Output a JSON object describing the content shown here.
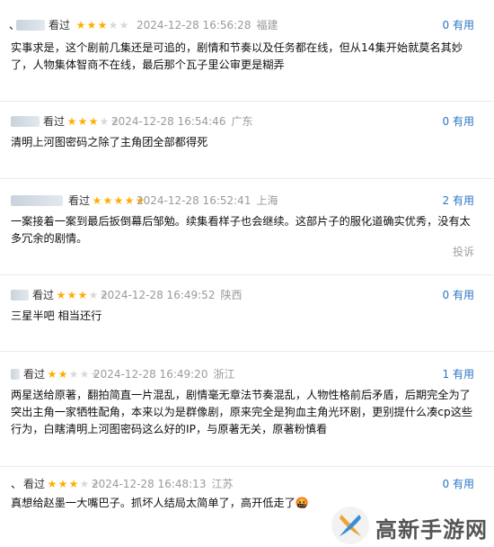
{
  "reviews": [
    {
      "watched": "看过",
      "rating": 3,
      "time": "2024-12-28 16:56:28",
      "location": "福建",
      "useful_count": "0",
      "useful_label": "有用",
      "content": "实事求是，这个剧前几集还是可追的，剧情和节奏以及任务都在线，但从14集开始就莫名其妙了，人物集体智商不在线，最后那个瓦子里公审更是糊弄"
    },
    {
      "watched": "看过",
      "rating": 3,
      "time": "2024-12-28 16:54:46",
      "location": "广东",
      "useful_count": "0",
      "useful_label": "有用",
      "content": "清明上河图密码之除了主角团全部都得死"
    },
    {
      "watched": "看过",
      "rating": 5,
      "time": "2024-12-28 16:52:41",
      "location": "上海",
      "useful_count": "2",
      "useful_label": "有用",
      "content": "一案接着一案到最后扳倒幕后邹勉。续集看样子也会继续。这部片子的服化道确实优秀，没有太多冗余的剧情。",
      "report": "投诉"
    },
    {
      "watched": "看过",
      "rating": 3,
      "time": "2024-12-28 16:49:52",
      "location": "陕西",
      "useful_count": "0",
      "useful_label": "有用",
      "content": "三星半吧 相当还行"
    },
    {
      "watched": "看过",
      "rating": 2,
      "time": "2024-12-28 16:49:20",
      "location": "浙江",
      "useful_count": "1",
      "useful_label": "有用",
      "content": "两星送给原著，翻拍简直一片混乱，剧情毫无章法节奏混乱，人物性格前后矛盾，后期完全为了突出主角一家牺牲配角，本来以为是群像剧，原来完全是狗血主角光环剧，更别提什么凑cp这些行为，白瞎清明上河图密码这么好的IP，与原著无关，原著粉慎看"
    },
    {
      "watched": "看过",
      "rating": 3,
      "time": "2024-12-28 16:48:13",
      "location": "江苏",
      "useful_count": "0",
      "useful_label": "有用",
      "content": "真想给赵墨一大嘴巴子。抓坏人结局太简单了，高开低走了🤬"
    }
  ],
  "watermark": {
    "text": "高新手游网"
  },
  "colors": {
    "star_on": "#ffae00",
    "star_off": "#d9d9d9",
    "link": "#2a76c8",
    "meta": "#9a9a9a"
  }
}
